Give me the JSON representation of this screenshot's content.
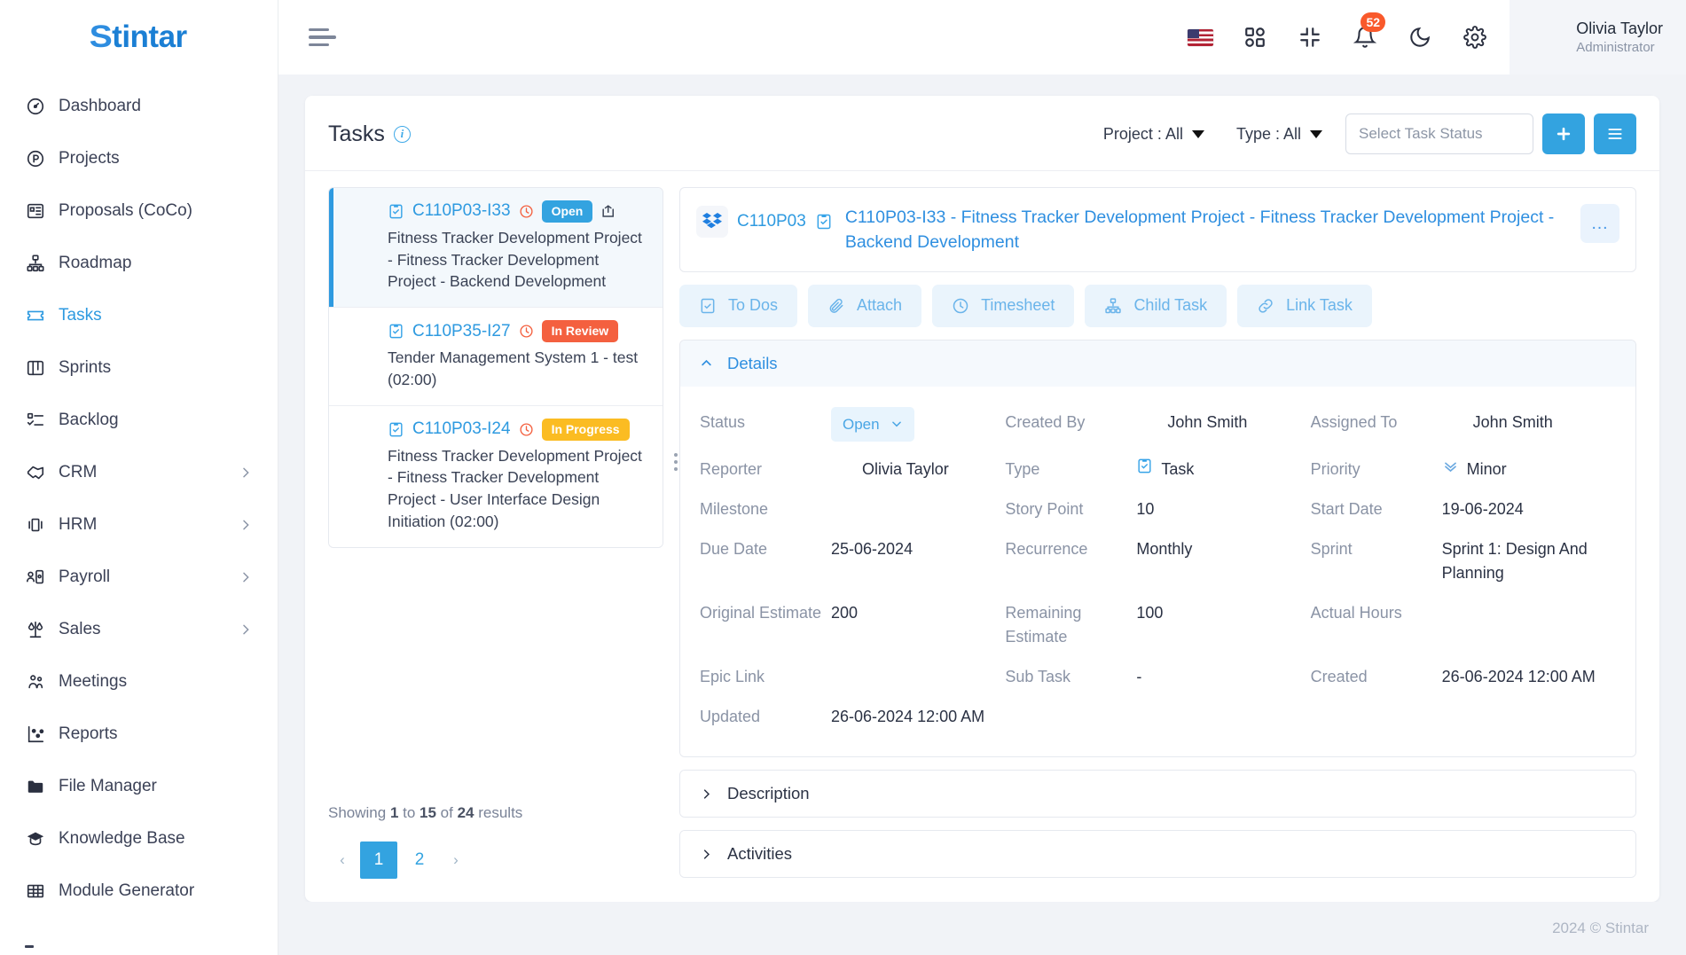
{
  "brand": {
    "name": "Stintar",
    "first_letter": "S",
    "rest": "tintar"
  },
  "sidebar": {
    "items": [
      {
        "label": "Dashboard",
        "icon": "gauge-icon",
        "active": false,
        "expandable": false
      },
      {
        "label": "Projects",
        "icon": "project-circle-icon",
        "active": false,
        "expandable": false
      },
      {
        "label": "Proposals (CoCo)",
        "icon": "proposal-icon",
        "active": false,
        "expandable": false
      },
      {
        "label": "Roadmap",
        "icon": "hierarchy-icon",
        "active": false,
        "expandable": false
      },
      {
        "label": "Tasks",
        "icon": "ticket-icon",
        "active": true,
        "expandable": false
      },
      {
        "label": "Sprints",
        "icon": "board-icon",
        "active": false,
        "expandable": false
      },
      {
        "label": "Backlog",
        "icon": "checklist-icon",
        "active": false,
        "expandable": false
      },
      {
        "label": "CRM",
        "icon": "handshake-icon",
        "active": false,
        "expandable": true
      },
      {
        "label": "HRM",
        "icon": "hrm-icon",
        "active": false,
        "expandable": true
      },
      {
        "label": "Payroll",
        "icon": "payroll-icon",
        "active": false,
        "expandable": true
      },
      {
        "label": "Sales",
        "icon": "scales-icon",
        "active": false,
        "expandable": true
      },
      {
        "label": "Meetings",
        "icon": "people-icon",
        "active": false,
        "expandable": false
      },
      {
        "label": "Reports",
        "icon": "scatter-chart-icon",
        "active": false,
        "expandable": false
      },
      {
        "label": "File Manager",
        "icon": "folder-icon",
        "active": false,
        "expandable": false
      },
      {
        "label": "Knowledge Base",
        "icon": "graduation-cap-icon",
        "active": false,
        "expandable": false
      },
      {
        "label": "Module Generator",
        "icon": "grid-table-icon",
        "active": false,
        "expandable": false
      }
    ]
  },
  "topbar": {
    "menu_toggle": "hamburger-icon",
    "language_flag": "us-flag",
    "apps_icon": "apps-grid-icon",
    "compress_icon": "compress-icon",
    "notification_icon": "bell-icon",
    "notification_count": "52",
    "theme_icon": "moon-icon",
    "settings_icon": "gear-icon",
    "user": {
      "name": "Olivia Taylor",
      "role": "Administrator"
    }
  },
  "page": {
    "title": "Tasks",
    "filters": [
      {
        "label": "Project : All"
      },
      {
        "label": "Type : All"
      }
    ],
    "status_search_placeholder": "Select Task Status",
    "status_search_value": "",
    "add_button_icon": "plus-icon",
    "list_button_icon": "list-icon"
  },
  "task_list": {
    "items": [
      {
        "id": "C110P03-I33",
        "status": "Open",
        "status_color": "#33a3e0",
        "description": "Fitness Tracker Development Project - Fitness Tracker Development Project - Backend Development",
        "selected": true,
        "has_share": true,
        "avatar": "user-photo"
      },
      {
        "id": "C110P35-I27",
        "status": "In Review",
        "status_color": "#f4603f",
        "description": "Tender Management System 1 - test (02:00)",
        "selected": false,
        "has_share": false,
        "avatar": "placeholder-avatar"
      },
      {
        "id": "C110P03-I24",
        "status": "In Progress",
        "status_color": "#fbbc22",
        "description": "Fitness Tracker Development Project - Fitness Tracker Development Project - User Interface Design Initiation (02:00)",
        "selected": false,
        "has_share": false,
        "avatar": "user-photo-dark"
      }
    ],
    "showing_prefix": "Showing ",
    "showing_from": "1",
    "showing_mid": " to ",
    "showing_to": "15",
    "showing_of": " of ",
    "showing_total": "24",
    "showing_suffix": " results",
    "pagination": {
      "prev": "‹",
      "pages": [
        "1",
        "2"
      ],
      "active_page": "1",
      "next": "›"
    }
  },
  "detail": {
    "project_code": "C110P03",
    "title": "C110P03-I33 - Fitness Tracker Development Project - Fitness Tracker Development Project - Backend Development",
    "more_label": "…",
    "tabs": [
      {
        "label": "To Dos",
        "icon": "todo-icon"
      },
      {
        "label": "Attach",
        "icon": "attachment-icon"
      },
      {
        "label": "Timesheet",
        "icon": "clock-icon"
      },
      {
        "label": "Child Task",
        "icon": "hierarchy-icon"
      },
      {
        "label": "Link Task",
        "icon": "link-icon"
      }
    ],
    "details_panel": {
      "title": "Details",
      "expanded": true,
      "fields": [
        {
          "label": "Status",
          "value": "Open",
          "type": "select"
        },
        {
          "label": "Created By",
          "value": "John Smith",
          "type": "avatar"
        },
        {
          "label": "Assigned To",
          "value": "John Smith",
          "type": "avatar"
        },
        {
          "label": "Reporter",
          "value": "Olivia Taylor",
          "type": "avatar"
        },
        {
          "label": "Type",
          "value": "Task",
          "type": "task-icon"
        },
        {
          "label": "Priority",
          "value": "Minor",
          "type": "priority-icon"
        },
        {
          "label": "Milestone",
          "value": "",
          "type": "text"
        },
        {
          "label": "Story Point",
          "value": "10",
          "type": "text"
        },
        {
          "label": "Start Date",
          "value": "19-06-2024",
          "type": "text"
        },
        {
          "label": "Due Date",
          "value": "25-06-2024",
          "type": "text"
        },
        {
          "label": "Recurrence",
          "value": "Monthly",
          "type": "text"
        },
        {
          "label": "Sprint",
          "value": "Sprint 1: Design And Planning",
          "type": "text"
        },
        {
          "label": "Original Estimate",
          "value": "200",
          "type": "text"
        },
        {
          "label": "Remaining Estimate",
          "value": "100",
          "type": "text"
        },
        {
          "label": "Actual Hours",
          "value": "",
          "type": "text"
        },
        {
          "label": "Epic Link",
          "value": "",
          "type": "text"
        },
        {
          "label": "Sub Task",
          "value": "-",
          "type": "text"
        },
        {
          "label": "Created",
          "value": "26-06-2024 12:00 AM",
          "type": "text"
        },
        {
          "label": "Updated",
          "value": "26-06-2024 12:00 AM",
          "type": "text"
        }
      ]
    },
    "collapsed_panels": [
      {
        "title": "Description",
        "expanded": false
      },
      {
        "title": "Activities",
        "expanded": false
      }
    ]
  },
  "footer": {
    "copyright": "2024 © Stintar"
  },
  "colors": {
    "accent": "#33a3e0",
    "link": "#2e9ae0",
    "open": "#33a3e0",
    "in_review": "#f4603f",
    "in_progress": "#fbbc22",
    "badge": "#f9592b"
  }
}
